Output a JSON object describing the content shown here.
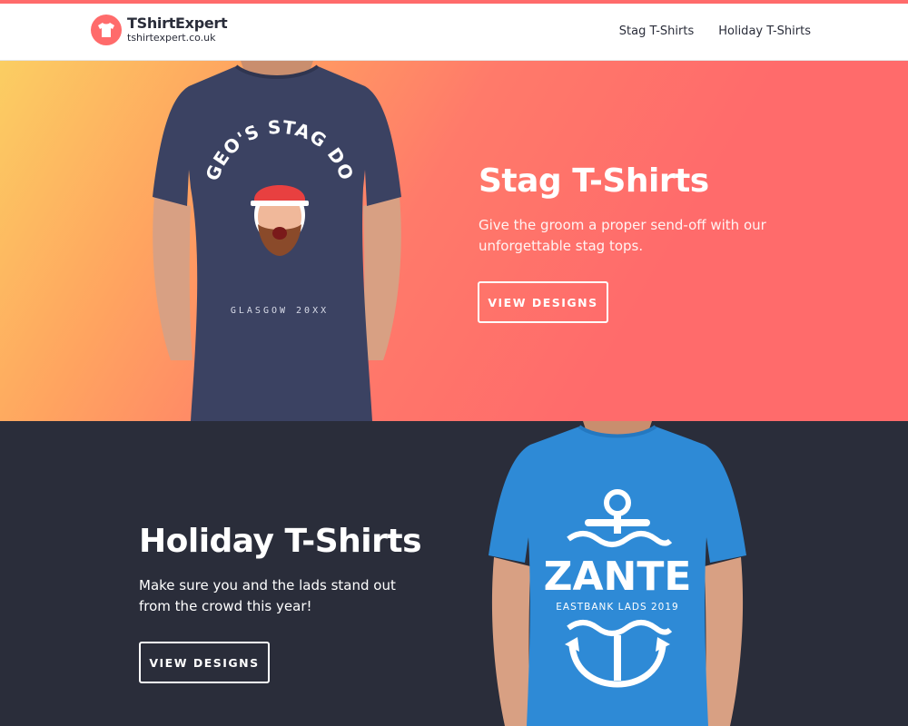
{
  "brand": {
    "name": "TShirtExpert",
    "domain": "tshirtexpert.co.uk",
    "accent": "#ff6b6b"
  },
  "nav": {
    "items": [
      {
        "label": "Stag T-Shirts"
      },
      {
        "label": "Holiday T-Shirts"
      }
    ]
  },
  "stag_section": {
    "title": "Stag T-Shirts",
    "text": "Give the groom a proper send-off with our unforgettable stag tops.",
    "button": "VIEW DESIGNS",
    "shirt_print": {
      "top": "GEO'S STAG DO",
      "bottom": "GLASGOW 20XX"
    }
  },
  "holiday_section": {
    "title": "Holiday T-Shirts",
    "text": "Make sure you and the lads stand out from the crowd this year!",
    "button": "VIEW DESIGNS",
    "shirt_print": {
      "main": "ZANTE",
      "sub": "EASTBANK LADS 2019"
    }
  },
  "colors": {
    "dark": "#2a2d3a",
    "stag_shirt": "#3b4262",
    "holiday_shirt": "#2e8ad6"
  }
}
